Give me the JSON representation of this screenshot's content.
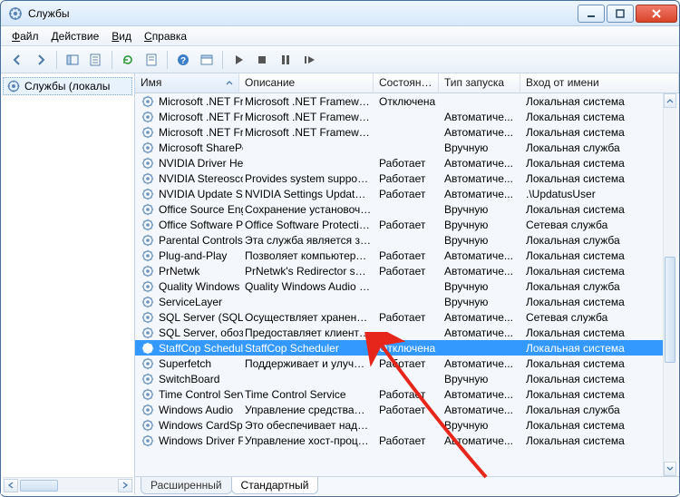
{
  "window": {
    "title": "Службы"
  },
  "menu": {
    "file": "Файл",
    "action": "Действие",
    "view": "Вид",
    "help": "Справка"
  },
  "tree": {
    "root": "Службы (локалы"
  },
  "columns": {
    "name": "Имя",
    "description": "Описание",
    "state": "Состояние",
    "startup": "Тип запуска",
    "logon": "Вход от имени"
  },
  "services": [
    {
      "name": "Microsoft .NET Fr...",
      "desc": "Microsoft .NET Framewor...",
      "state": "Отключена",
      "start": "",
      "logon": "Локальная система",
      "selected": false
    },
    {
      "name": "Microsoft .NET Fr...",
      "desc": "Microsoft .NET Framewor...",
      "state": "",
      "start": "Автоматиче...",
      "logon": "Локальная система"
    },
    {
      "name": "Microsoft .NET Fr...",
      "desc": "Microsoft .NET Framewor...",
      "state": "",
      "start": "Автоматиче...",
      "logon": "Локальная система"
    },
    {
      "name": "Microsoft SharePo...",
      "desc": "",
      "state": "",
      "start": "Вручную",
      "logon": "Локальная служба"
    },
    {
      "name": "NVIDIA Driver Hel...",
      "desc": "",
      "state": "Работает",
      "start": "Автоматиче...",
      "logon": "Локальная система"
    },
    {
      "name": "NVIDIA Stereosco...",
      "desc": "Provides system support f...",
      "state": "Работает",
      "start": "Автоматиче...",
      "logon": "Локальная система"
    },
    {
      "name": "NVIDIA Update Se...",
      "desc": "NVIDIA Settings Update M...",
      "state": "Работает",
      "start": "Автоматиче...",
      "logon": ".\\UpdatusUser"
    },
    {
      "name": "Office  Source Eng...",
      "desc": "Сохранение установочн...",
      "state": "",
      "start": "Вручную",
      "logon": "Локальная система"
    },
    {
      "name": "Office Software Pr...",
      "desc": "Office Software Protection...",
      "state": "Работает",
      "start": "Вручную",
      "logon": "Сетевая служба"
    },
    {
      "name": "Parental Controls",
      "desc": "Эта служба является загл...",
      "state": "",
      "start": "Вручную",
      "logon": "Локальная служба"
    },
    {
      "name": "Plug-and-Play",
      "desc": "Позволяет компьютеру р...",
      "state": "Работает",
      "start": "Автоматиче...",
      "logon": "Локальная система"
    },
    {
      "name": "PrNetwk",
      "desc": "PrNetwk's Redirector service",
      "state": "Работает",
      "start": "Автоматиче...",
      "logon": "Локальная система"
    },
    {
      "name": "Quality Windows ...",
      "desc": "Quality Windows Audio Vi...",
      "state": "",
      "start": "Вручную",
      "logon": "Локальная служба"
    },
    {
      "name": "ServiceLayer",
      "desc": "",
      "state": "",
      "start": "Вручную",
      "logon": "Локальная система"
    },
    {
      "name": "SQL Server (SQLEX...",
      "desc": "Осуществляет хранение ...",
      "state": "Работает",
      "start": "Автоматиче...",
      "logon": "Сетевая служба"
    },
    {
      "name": "SQL Server, обозр...",
      "desc": "Предоставляет клиентск...",
      "state": "",
      "start": "Автоматиче...",
      "logon": "Локальная система"
    },
    {
      "name": "StaffCop Scheduler",
      "desc": "StaffCop Scheduler",
      "state": "Отключена",
      "start": "",
      "logon": "Локальная система",
      "selected": true
    },
    {
      "name": "Superfetch",
      "desc": "Поддерживает и улучша...",
      "state": "Работает",
      "start": "Автоматиче...",
      "logon": "Локальная система"
    },
    {
      "name": "SwitchBoard",
      "desc": "",
      "state": "",
      "start": "Вручную",
      "logon": "Локальная система"
    },
    {
      "name": "Time Control Serv...",
      "desc": "Time Control Service",
      "state": "Работает",
      "start": "Автоматиче...",
      "logon": "Локальная система"
    },
    {
      "name": "Windows Audio",
      "desc": "Управление средствами ...",
      "state": "Работает",
      "start": "Автоматиче...",
      "logon": "Локальная служба"
    },
    {
      "name": "Windows CardSpa...",
      "desc": "Это обеспечивает надеж...",
      "state": "",
      "start": "Вручную",
      "logon": "Локальная система"
    },
    {
      "name": "Windows Driver F...",
      "desc": "Управление хост-процес...",
      "state": "Работает",
      "start": "Автоматиче...",
      "logon": "Локальная система"
    }
  ],
  "tabs": {
    "extended": "Расширенный",
    "standard": "Стандартный"
  }
}
